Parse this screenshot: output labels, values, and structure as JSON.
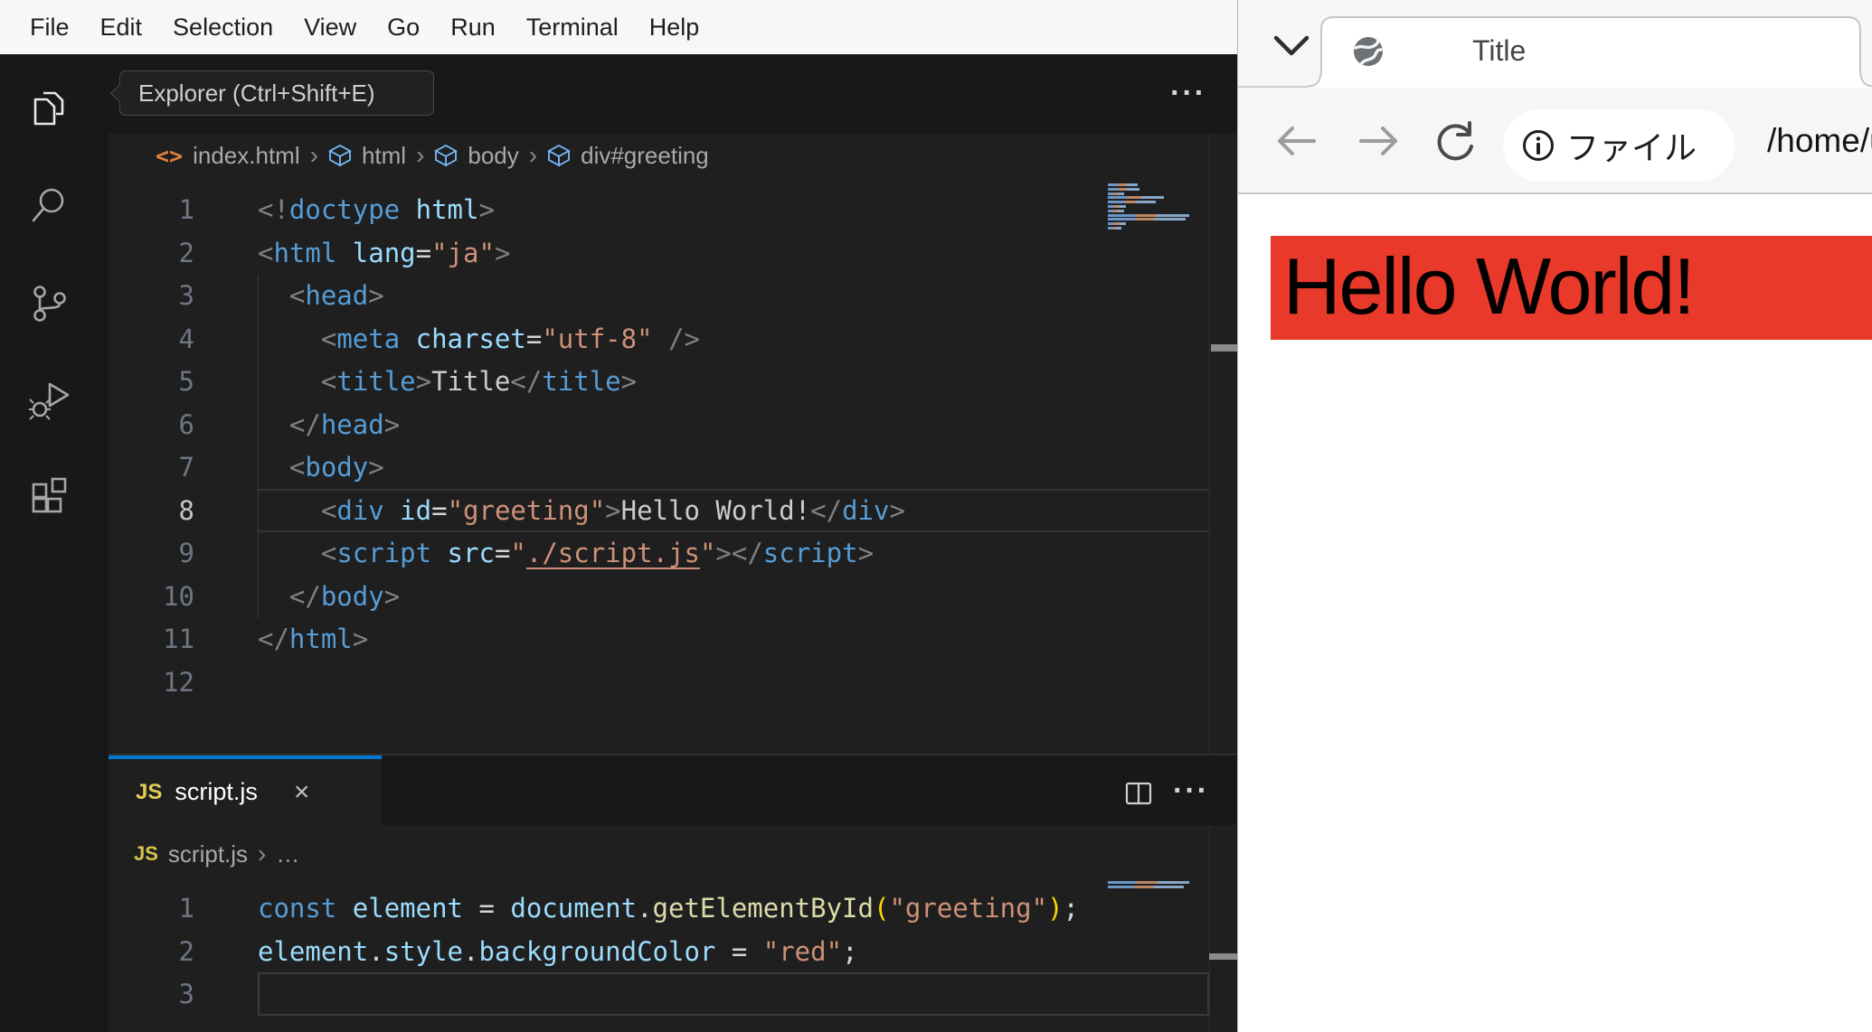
{
  "colors": {
    "accent": "#0078d4",
    "page_red": "#e8392b",
    "menubar_bg": "#f8f7f5"
  },
  "vscode": {
    "menubar": {
      "items": [
        "File",
        "Edit",
        "Selection",
        "View",
        "Go",
        "Run",
        "Terminal",
        "Help"
      ]
    },
    "activity": {
      "tooltip": "Explorer (Ctrl+Shift+E)",
      "icons": [
        "explorer",
        "search",
        "source-control",
        "run-and-debug",
        "extensions"
      ]
    },
    "html_editor": {
      "actions_more": "···",
      "breadcrumb": {
        "file": "index.html",
        "sep": "›",
        "seg1": "html",
        "seg2": "body",
        "seg3": "div#greeting"
      },
      "code": {
        "active": 8,
        "hl": "lines",
        "brightLn": true,
        "lines": [
          [
            [
              "<!",
              "p"
            ],
            [
              "doctype",
              "tag"
            ],
            [
              " ",
              "sp"
            ],
            [
              "html",
              "attr"
            ],
            [
              ">",
              "p"
            ]
          ],
          [
            [
              "<",
              "p"
            ],
            [
              "html",
              "tag"
            ],
            [
              " ",
              "sp"
            ],
            [
              "lang",
              "attr"
            ],
            [
              "=",
              "op"
            ],
            [
              "\"ja\"",
              "str"
            ],
            [
              ">",
              "p"
            ]
          ],
          [
            [
              "  ",
              "sp"
            ],
            [
              "<",
              "p"
            ],
            [
              "head",
              "tag"
            ],
            [
              ">",
              "p"
            ]
          ],
          [
            [
              "    ",
              "sp"
            ],
            [
              "<",
              "p"
            ],
            [
              "meta",
              "tag"
            ],
            [
              " ",
              "sp"
            ],
            [
              "charset",
              "attr"
            ],
            [
              "=",
              "op"
            ],
            [
              "\"utf-8\"",
              "str"
            ],
            [
              " /",
              "p"
            ],
            [
              ">",
              "p"
            ]
          ],
          [
            [
              "    ",
              "sp"
            ],
            [
              "<",
              "p"
            ],
            [
              "title",
              "tag"
            ],
            [
              ">",
              "p"
            ],
            [
              "Title",
              "txt"
            ],
            [
              "</",
              "p"
            ],
            [
              "title",
              "tag"
            ],
            [
              ">",
              "p"
            ]
          ],
          [
            [
              "  ",
              "sp"
            ],
            [
              "</",
              "p"
            ],
            [
              "head",
              "tag"
            ],
            [
              ">",
              "p"
            ]
          ],
          [
            [
              "  ",
              "sp"
            ],
            [
              "<",
              "p"
            ],
            [
              "body",
              "tag"
            ],
            [
              ">",
              "p"
            ]
          ],
          [
            [
              "    ",
              "sp"
            ],
            [
              "<",
              "p"
            ],
            [
              "div",
              "tag"
            ],
            [
              " ",
              "sp"
            ],
            [
              "id",
              "attr"
            ],
            [
              "=",
              "op"
            ],
            [
              "\"greeting\"",
              "str"
            ],
            [
              ">",
              "p"
            ],
            [
              "Hello World!",
              "txt"
            ],
            [
              "</",
              "p"
            ],
            [
              "div",
              "tag"
            ],
            [
              ">",
              "p"
            ]
          ],
          [
            [
              "    ",
              "sp"
            ],
            [
              "<",
              "p"
            ],
            [
              "script",
              "tag"
            ],
            [
              " ",
              "sp"
            ],
            [
              "src",
              "attr"
            ],
            [
              "=",
              "op"
            ],
            [
              "\"",
              "str"
            ],
            [
              "./script.js",
              "link"
            ],
            [
              "\"",
              "str"
            ],
            [
              ">",
              "p"
            ],
            [
              "</",
              "p"
            ],
            [
              "script",
              "tag"
            ],
            [
              ">",
              "p"
            ]
          ],
          [
            [
              "  ",
              "sp"
            ],
            [
              "</",
              "p"
            ],
            [
              "body",
              "tag"
            ],
            [
              ">",
              "p"
            ]
          ],
          [
            [
              "</",
              "p"
            ],
            [
              "html",
              "tag"
            ],
            [
              ">",
              "p"
            ]
          ],
          []
        ]
      }
    },
    "js_editor": {
      "tab": {
        "badge": "JS",
        "label": "script.js",
        "close": "×"
      },
      "actions_more": "···",
      "breadcrumb": {
        "badge": "JS",
        "file": "script.js",
        "sep": "›",
        "more": "…"
      },
      "code": {
        "active": 3,
        "hl": "box",
        "brightLn": false,
        "lines": [
          [
            [
              "const",
              "kw"
            ],
            [
              " ",
              "sp"
            ],
            [
              "element",
              "var"
            ],
            [
              " = ",
              "op"
            ],
            [
              "document",
              "var"
            ],
            [
              ".",
              "op"
            ],
            [
              "getElementById",
              "fn"
            ],
            [
              "(",
              "br"
            ],
            [
              "\"greeting\"",
              "str"
            ],
            [
              ")",
              "br"
            ],
            [
              ";",
              "op"
            ]
          ],
          [
            [
              "element",
              "var"
            ],
            [
              ".",
              "op"
            ],
            [
              "style",
              "var"
            ],
            [
              ".",
              "op"
            ],
            [
              "backgroundColor",
              "var"
            ],
            [
              " = ",
              "op"
            ],
            [
              "\"red\"",
              "str"
            ],
            [
              ";",
              "op"
            ]
          ],
          []
        ]
      }
    }
  },
  "browser": {
    "tab": {
      "title": "Title",
      "close": "×"
    },
    "toolbar": {
      "chip_label": "ファイル",
      "url": "/home/u"
    },
    "page": {
      "heading": "Hello World!"
    }
  }
}
